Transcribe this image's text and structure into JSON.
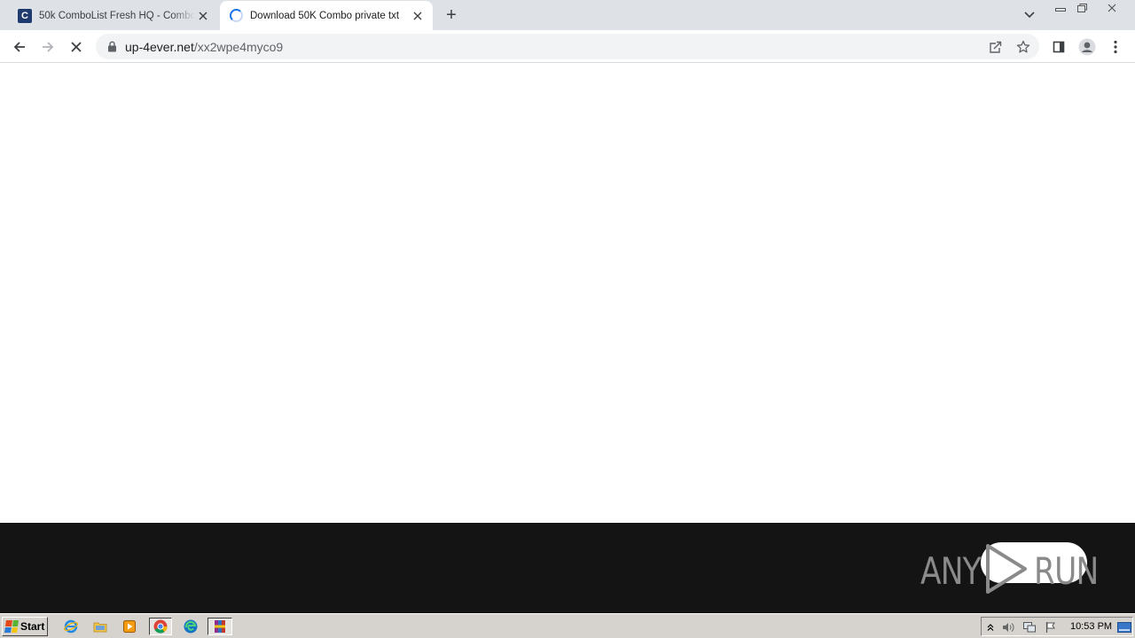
{
  "browser": {
    "tabs": [
      {
        "favicon_letter": "C",
        "title": "50k ComboList Fresh HQ - Combo List",
        "active": false
      },
      {
        "title": "Download 50K Combo private txt",
        "active": true,
        "loading": true
      }
    ],
    "new_tab_label": "+",
    "address": {
      "host": "up-4ever.net",
      "path": "/xx2wpe4myco9"
    }
  },
  "watermark": {
    "left": "ANY",
    "right": "RUN"
  },
  "taskbar": {
    "start_label": "Start",
    "clock": "10:53 PM",
    "quick_launch": [
      "internet-explorer-icon",
      "folder-icon",
      "media-player-icon",
      "chrome-icon",
      "edge-icon",
      "winrar-icon"
    ]
  },
  "colors": {
    "tabstrip": "#dee1e6",
    "omnibox": "#f1f3f4",
    "accent": "#1a73e8",
    "dark_band": "#141414",
    "taskbar": "#d6d3ce"
  }
}
